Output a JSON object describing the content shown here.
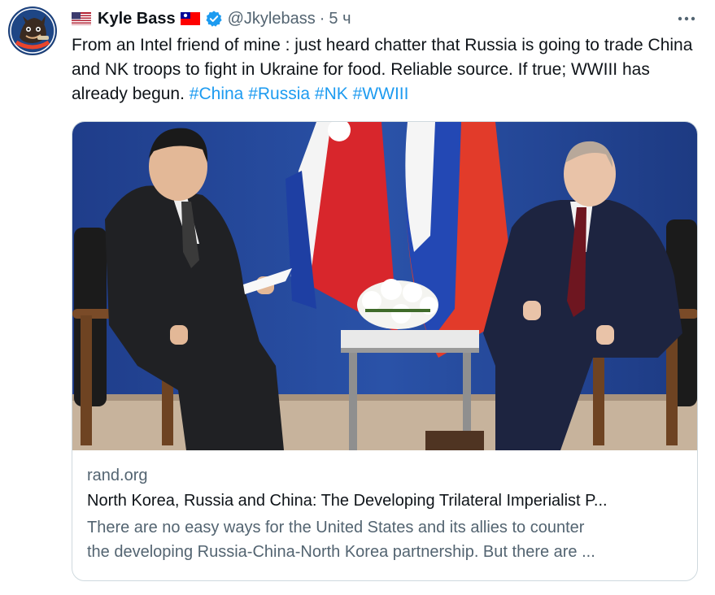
{
  "author": {
    "name": "Kyle Bass",
    "handle": "@Jkylebass",
    "time": "5 ч",
    "separator": "·"
  },
  "tweet": {
    "text_before": "From an Intel friend of mine : just heard chatter that Russia is going to trade China and NK troops to fight in Ukraine for food. Reliable source. If true; WWIII has already begun.",
    "hashtags": [
      "#China",
      "#Russia",
      "#NK",
      "#WWIII"
    ]
  },
  "card": {
    "domain": "rand.org",
    "title": "North Korea, Russia and China: The Developing Trilateral Imperialist P...",
    "description_line1": "There are no easy ways for the United States and its allies to counter",
    "description_line2": "the developing Russia-China-North Korea partnership. But there are ..."
  },
  "icons": {
    "avatar": "avatar-image",
    "flag_left": "us-flag-icon",
    "flag_right": "taiwan-flag-icon",
    "verified": "verified-badge-icon",
    "more": "more-icon"
  },
  "colors": {
    "link": "#1d9bf0",
    "verified": "#1d9bf0",
    "secondary_text": "#536471"
  }
}
